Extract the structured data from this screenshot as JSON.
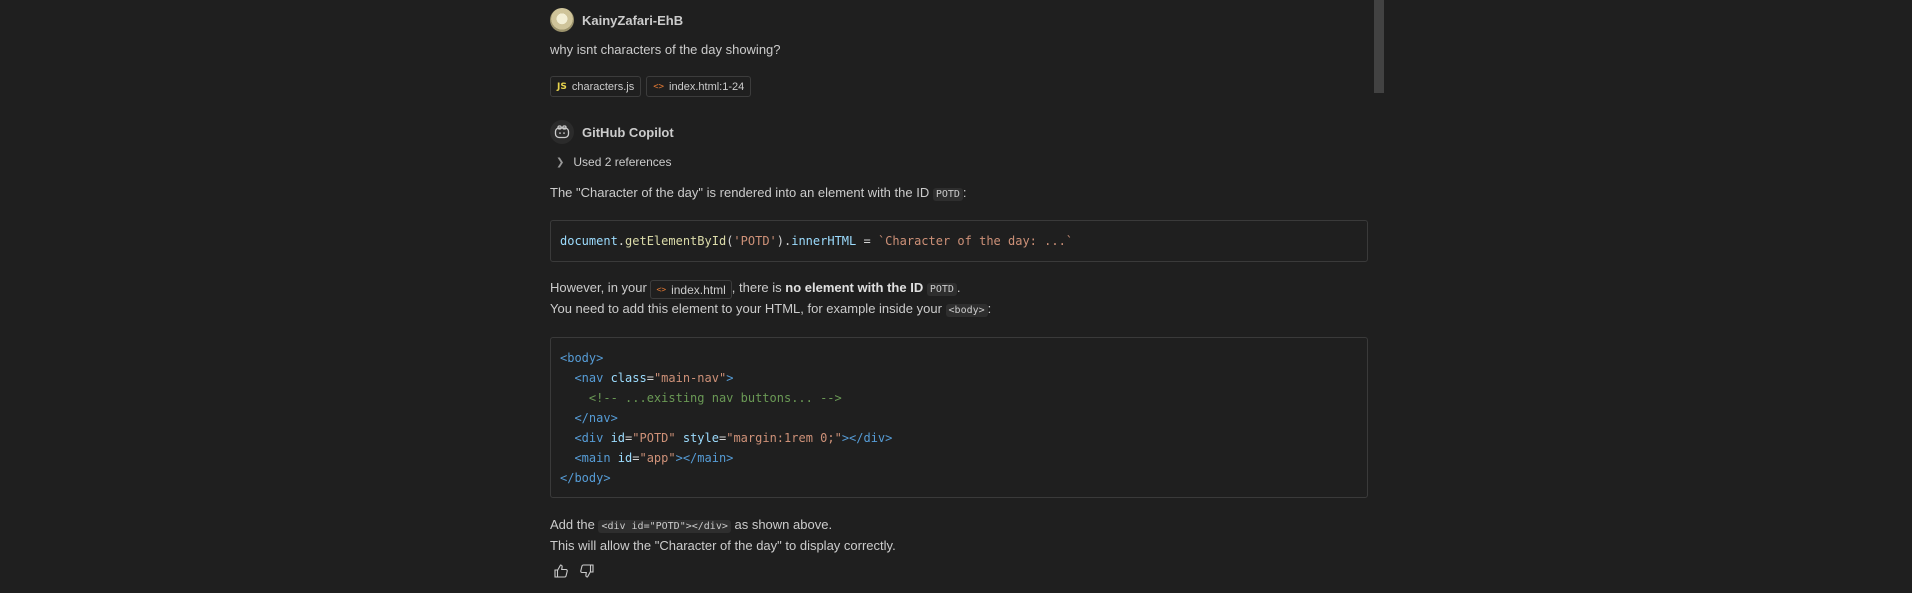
{
  "user": {
    "name": "KainyZafari-EhB",
    "message": "why isnt characters of the day showing?"
  },
  "attachments": [
    {
      "icon": "js-file-icon",
      "label": "characters.js"
    },
    {
      "icon": "html-file-icon",
      "label": "index.html:1-24"
    }
  ],
  "assistant": {
    "name": "GitHub Copilot",
    "references": "Used 2 references",
    "p1_pre": "The \"Character of the day\" is rendered into an element with the ID ",
    "p1_code": "POTD",
    "p1_post": ":",
    "code1": {
      "t1": "document",
      "t2": ".",
      "t3": "getElementById",
      "t4": "(",
      "t5": "'POTD'",
      "t6": ").",
      "t7": "innerHTML",
      "t8": " = ",
      "t9": "`Character of the day: ...`"
    },
    "p2_pre": "However, in your ",
    "p2_file": "index.html",
    "p2_mid": ", there is ",
    "p2_bold": "no element with the ID ",
    "p2_code": "POTD",
    "p2_end": ".",
    "p3_pre": "You need to add this element to your HTML, for example inside your ",
    "p3_code": "<body>",
    "p3_end": ":",
    "code2": {
      "l1": "<body>",
      "l2a": "  <nav ",
      "l2b": "class",
      "l2c": "=",
      "l2d": "\"main-nav\"",
      "l2e": ">",
      "l3": "    <!-- ...existing nav buttons... -->",
      "l4": "  </nav>",
      "l5a": "  <div ",
      "l5b": "id",
      "l5c": "=",
      "l5d": "\"POTD\"",
      "l5e": " style",
      "l5f": "=",
      "l5g": "\"margin:1rem 0;\"",
      "l5h": "></div>",
      "l6a": "  <main ",
      "l6b": "id",
      "l6c": "=",
      "l6d": "\"app\"",
      "l6e": "></main>",
      "l7": "</body>"
    },
    "p4_pre": "Add the ",
    "p4_code": "<div id=\"POTD\"></div>",
    "p4_end": " as shown above.",
    "p5": "This will allow the \"Character of the day\" to display correctly."
  },
  "icons": {
    "helpful": "thumbs-up-icon",
    "unhelpful": "thumbs-down-icon",
    "references": "chevron-right-icon"
  }
}
